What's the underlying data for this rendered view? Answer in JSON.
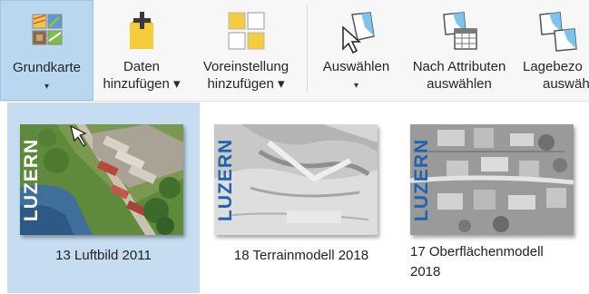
{
  "ribbon": {
    "grundkarte": {
      "label": "Grundkarte",
      "caret": "▾"
    },
    "daten": {
      "line1": "Daten",
      "line2": "hinzufügen ▾"
    },
    "voreinstellung": {
      "line1": "Voreinstellung",
      "line2": "hinzufügen ▾"
    },
    "auswaehlen": {
      "label": "Auswählen",
      "caret": "▾"
    },
    "nach_attributen": {
      "line1": "Nach Attributen",
      "line2": "auswählen"
    },
    "lagebezogen": {
      "line1": "Lagebezo",
      "line2": "auswäh"
    }
  },
  "gallery": {
    "tiles": [
      {
        "label": "13 Luftbild 2011",
        "brand": "LUZERN"
      },
      {
        "label": "18 Terrainmodell 2018",
        "brand": "LUZERN"
      },
      {
        "label_line1": "17 Oberflächenmodell",
        "label_line2": "2018",
        "brand": "LUZERN"
      }
    ]
  },
  "colors": {
    "selected_button": "#b9d7ee",
    "selected_tile": "#c6ddf1",
    "brand_blue": "#1f63b0"
  }
}
